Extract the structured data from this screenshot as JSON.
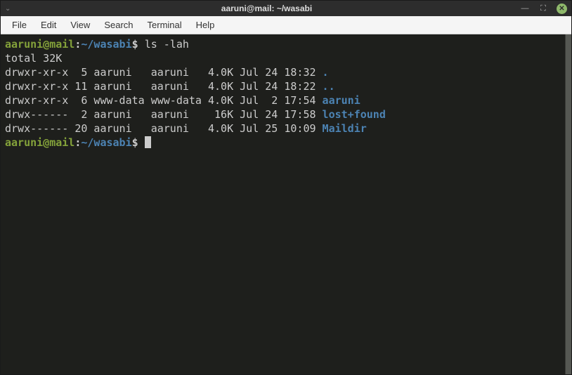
{
  "window": {
    "title": "aaruni@mail: ~/wasabi"
  },
  "menu": {
    "file": "File",
    "edit": "Edit",
    "view": "View",
    "search": "Search",
    "terminal": "Terminal",
    "help": "Help"
  },
  "prompt": {
    "user": "aaruni@mail",
    "colon": ":",
    "path": "~/wasabi",
    "dollar": "$"
  },
  "command": "ls -lah",
  "total_line": "total 32K",
  "listing": [
    {
      "perms": "drwxr-xr-x",
      "links": " 5",
      "owner": "aaruni  ",
      "group": "aaruni  ",
      "size": "4.0K",
      "date": "Jul 24 18:32",
      "name": "."
    },
    {
      "perms": "drwxr-xr-x",
      "links": "11",
      "owner": "aaruni  ",
      "group": "aaruni  ",
      "size": "4.0K",
      "date": "Jul 24 18:22",
      "name": ".."
    },
    {
      "perms": "drwxr-xr-x",
      "links": " 6",
      "owner": "www-data",
      "group": "www-data",
      "size": "4.0K",
      "date": "Jul  2 17:54",
      "name": "aaruni"
    },
    {
      "perms": "drwx------",
      "links": " 2",
      "owner": "aaruni  ",
      "group": "aaruni  ",
      "size": " 16K",
      "date": "Jul 24 17:58",
      "name": "lost+found"
    },
    {
      "perms": "drwx------",
      "links": "20",
      "owner": "aaruni  ",
      "group": "aaruni  ",
      "size": "4.0K",
      "date": "Jul 25 10:09",
      "name": "Maildir"
    }
  ]
}
